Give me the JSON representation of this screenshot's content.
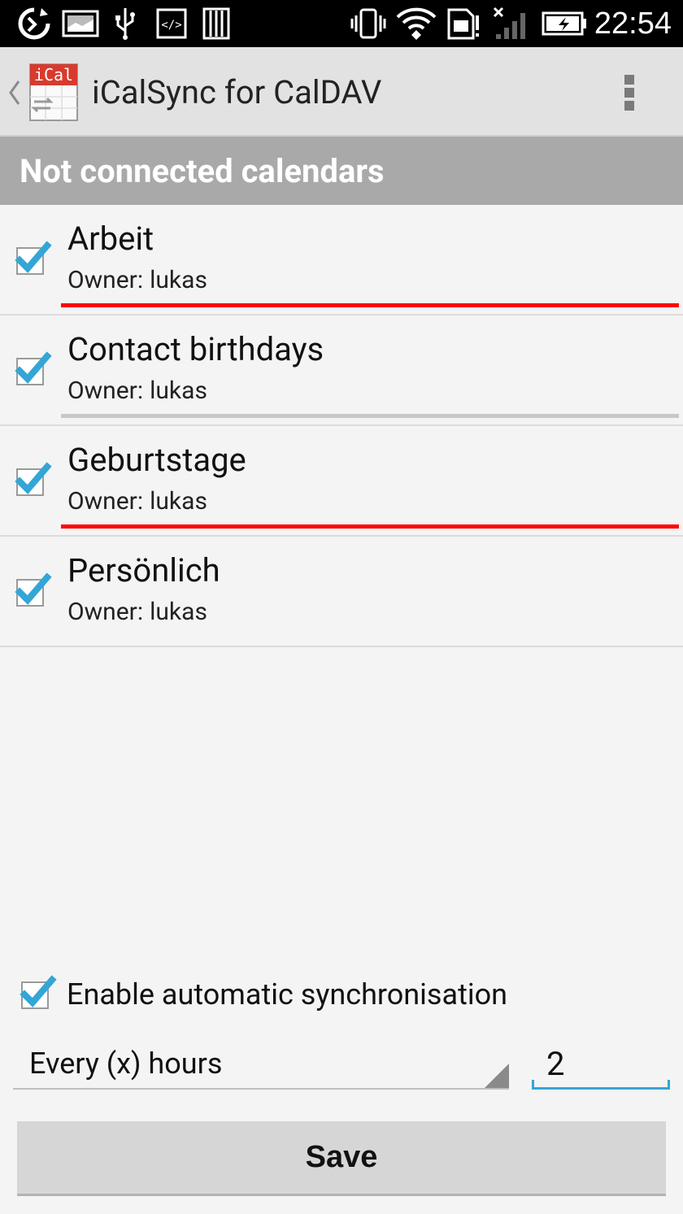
{
  "status_bar": {
    "time": "22:54",
    "icons": [
      "sync-icon",
      "image-icon",
      "usb-icon",
      "code-icon",
      "storage-icon",
      "vibrate-icon",
      "wifi-icon",
      "sim-icon",
      "signal-icon",
      "battery-charging-icon"
    ]
  },
  "action_bar": {
    "app_icon_label": "iCal",
    "title": "iCalSync for CalDAV"
  },
  "section": {
    "title": "Not connected calendars"
  },
  "owner_label": "Owner:",
  "calendars": [
    {
      "name": "Arbeit",
      "owner": "lukas",
      "checked": true,
      "underline_color": "#ff0000"
    },
    {
      "name": "Contact birthdays",
      "owner": "lukas",
      "checked": true,
      "underline_color": "#c8c8c8"
    },
    {
      "name": "Geburtstage",
      "owner": "lukas",
      "checked": true,
      "underline_color": "#ff0000"
    },
    {
      "name": "Persönlich",
      "owner": "lukas",
      "checked": true,
      "underline_color": ""
    }
  ],
  "auto_sync": {
    "label": "Enable automatic synchronisation",
    "checked": true
  },
  "interval": {
    "selected": "Every (x) hours",
    "value": "2"
  },
  "save_label": "Save",
  "colors": {
    "accent": "#33a6d6",
    "check": "#33a6d6",
    "header_bg": "#a9a9a9"
  }
}
